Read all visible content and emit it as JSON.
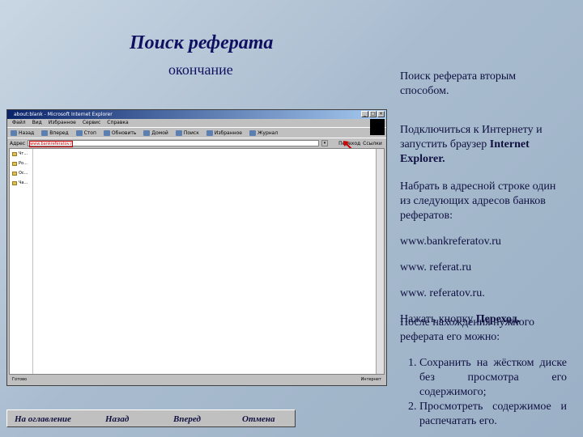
{
  "slide": {
    "title": "Поиск реферата",
    "subtitle": "окончание"
  },
  "browser": {
    "window_title": "about:blank - Microsoft Internet Explorer",
    "menu": [
      "Файл",
      "Вид",
      "Избранное",
      "Сервис",
      "Справка"
    ],
    "toolbar": [
      "Назад",
      "Вперед",
      "Стоп",
      "Обновить",
      "Домой",
      "Поиск",
      "Избранное",
      "Журнал"
    ],
    "address_label": "Адрес",
    "address_value": "www.bankreferatov.ru",
    "go_label": "Переход",
    "links_label": "Ссылки",
    "sidebar": [
      "Чт...",
      "Ро...",
      "Ос...",
      "Ча..."
    ],
    "status_left": "Готово",
    "status_right": "Интернет"
  },
  "right": {
    "block1": "Поиск реферата вторым способом.",
    "block2_text": "Подключиться к Интернету и запустить браузер ",
    "block2_bold": "Internet Explorer.",
    "block3_text": "Набрать в адресной строке один из следующих адресов банков рефератов:",
    "urls": [
      "www.bankreferatov.ru",
      "www. referat.ru",
      "www. referatov.ru."
    ],
    "press_text": "Нажать кнопку ",
    "press_bold": "Переход.",
    "block4_text": "После нахождения нужного реферата его можно:",
    "steps": [
      "Сохранить на жёстком диске без просмотра его содержимого;",
      "Просмотреть содержимое и распечатать его."
    ]
  },
  "nav": {
    "toc": "На оглавление",
    "back": "Назад",
    "forward": "Вперед",
    "cancel": "Отмена"
  },
  "colors": {
    "title_text": "#101060",
    "highlight": "#d00000"
  }
}
